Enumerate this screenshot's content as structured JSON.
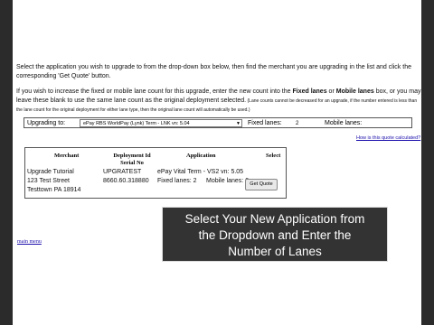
{
  "instructions": {
    "line1": "Select the application you wish to upgrade to from the drop-down box below, then find the merchant you are upgrading in the list and click the corresponding 'Get Quote' button.",
    "p2_a": "If you wish to increase the fixed or mobile lane count for this upgrade, enter the new count into the ",
    "p2_fixed": "Fixed lanes",
    "p2_or": " or ",
    "p2_mobile": "Mobile lanes",
    "p2_b": " box, or you may leave these blank to use the same lane count as the original deployment selected.",
    "p2_small": " (Lane counts cannot be decreased for an upgrade, if the number entered is less than the lane count for the original deployment for either lane type, then the original lane count will automatically be used.)"
  },
  "upgrade_bar": {
    "label": "Upgrading to:",
    "selected_app": "ePay RBS WorldPay (Lynk) Term - LNK vn: 5.04",
    "fixed_label": "Fixed lanes:",
    "fixed_value": "2",
    "mobile_label": "Mobile lanes:"
  },
  "quote_link": "How is this quote calculated?",
  "table": {
    "headers": {
      "merchant": "Merchant",
      "deployment": "Deployment Id",
      "serial": "Serial No",
      "application": "Application",
      "select": "Select"
    },
    "row": {
      "merchant_name": "Upgrade Tutorial",
      "street": "123 Test Street",
      "city": "Testtown PA 18914",
      "deployment_id": "UPGRATEST",
      "serial_no": "8660.60.318880",
      "application": "ePay Vital Term - VS2 vn: 5.05",
      "fixed_lanes": "Fixed lanes:  2",
      "mobile_lanes": "Mobile lanes:  0",
      "button": "Get Quote"
    }
  },
  "caption": {
    "line1": "Select Your New Application from",
    "line2": "the Dropdown and Enter the",
    "line3": "Number of Lanes"
  },
  "main_menu_link": "main menu"
}
